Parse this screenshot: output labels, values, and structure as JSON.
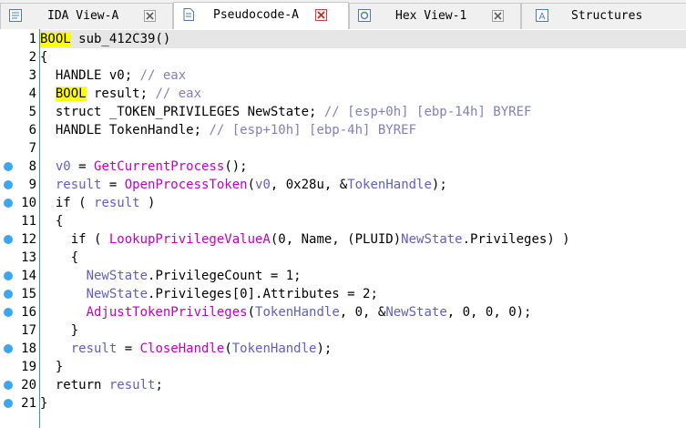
{
  "tabs": [
    {
      "label": "IDA View-A",
      "icon": "ida-view-icon",
      "active": false
    },
    {
      "label": "Pseudocode-A",
      "icon": "pseudocode-icon",
      "active": true
    },
    {
      "label": "Hex View-1",
      "icon": "hex-view-icon",
      "active": false
    },
    {
      "label": "Structures",
      "icon": "structures-icon",
      "active": false
    }
  ],
  "colors": {
    "function": "#c000c0",
    "comment": "#7f7fbf",
    "variable": "#5f5fbf",
    "highlight": "#ffff00",
    "breakpoint": "#3da6f0"
  },
  "code": {
    "lines": [
      {
        "n": "1",
        "bp": false,
        "segments": [
          [
            "kw",
            "BOOL"
          ],
          [
            "t",
            " sub_412C39()"
          ]
        ]
      },
      {
        "n": "2",
        "bp": false,
        "segments": [
          [
            "t",
            "{"
          ]
        ]
      },
      {
        "n": "3",
        "bp": false,
        "segments": [
          [
            "t",
            "  HANDLE v0; "
          ],
          [
            "cm",
            "// eax"
          ]
        ]
      },
      {
        "n": "4",
        "bp": false,
        "segments": [
          [
            "t",
            "  "
          ],
          [
            "kw",
            "BOOL"
          ],
          [
            "t",
            " result; "
          ],
          [
            "cm",
            "// eax"
          ]
        ]
      },
      {
        "n": "5",
        "bp": false,
        "segments": [
          [
            "t",
            "  struct _TOKEN_PRIVILEGES NewState; "
          ],
          [
            "cm",
            "// [esp+0h] [ebp-14h] BYREF"
          ]
        ]
      },
      {
        "n": "6",
        "bp": false,
        "segments": [
          [
            "t",
            "  HANDLE TokenHandle; "
          ],
          [
            "cm",
            "// [esp+10h] [ebp-4h] BYREF"
          ]
        ]
      },
      {
        "n": "7",
        "bp": false,
        "segments": [
          [
            "t",
            ""
          ]
        ]
      },
      {
        "n": "8",
        "bp": true,
        "segments": [
          [
            "t",
            "  "
          ],
          [
            "var",
            "v0"
          ],
          [
            "t",
            " = "
          ],
          [
            "fn",
            "GetCurrentProcess"
          ],
          [
            "t",
            "();"
          ]
        ]
      },
      {
        "n": "9",
        "bp": true,
        "segments": [
          [
            "t",
            "  "
          ],
          [
            "var",
            "result"
          ],
          [
            "t",
            " = "
          ],
          [
            "fn",
            "OpenProcessToken"
          ],
          [
            "t",
            "("
          ],
          [
            "var",
            "v0"
          ],
          [
            "t",
            ", 0x28u, &"
          ],
          [
            "var",
            "TokenHandle"
          ],
          [
            "t",
            ");"
          ]
        ]
      },
      {
        "n": "10",
        "bp": true,
        "segments": [
          [
            "t",
            "  if ( "
          ],
          [
            "var",
            "result"
          ],
          [
            "t",
            " )"
          ]
        ]
      },
      {
        "n": "11",
        "bp": false,
        "segments": [
          [
            "t",
            "  {"
          ]
        ]
      },
      {
        "n": "12",
        "bp": true,
        "segments": [
          [
            "t",
            "    if ( "
          ],
          [
            "fn",
            "LookupPrivilegeValueA"
          ],
          [
            "t",
            "(0, Name, (PLUID)"
          ],
          [
            "var",
            "NewState"
          ],
          [
            "t",
            ".Privileges) )"
          ]
        ]
      },
      {
        "n": "13",
        "bp": false,
        "segments": [
          [
            "t",
            "    {"
          ]
        ]
      },
      {
        "n": "14",
        "bp": true,
        "segments": [
          [
            "t",
            "      "
          ],
          [
            "var",
            "NewState"
          ],
          [
            "t",
            ".PrivilegeCount = 1;"
          ]
        ]
      },
      {
        "n": "15",
        "bp": true,
        "segments": [
          [
            "t",
            "      "
          ],
          [
            "var",
            "NewState"
          ],
          [
            "t",
            ".Privileges[0].Attributes = 2;"
          ]
        ]
      },
      {
        "n": "16",
        "bp": true,
        "segments": [
          [
            "t",
            "      "
          ],
          [
            "fn",
            "AdjustTokenPrivileges"
          ],
          [
            "t",
            "("
          ],
          [
            "var",
            "TokenHandle"
          ],
          [
            "t",
            ", 0, &"
          ],
          [
            "var",
            "NewState"
          ],
          [
            "t",
            ", 0, 0, 0);"
          ]
        ]
      },
      {
        "n": "17",
        "bp": false,
        "segments": [
          [
            "t",
            "    }"
          ]
        ]
      },
      {
        "n": "18",
        "bp": true,
        "segments": [
          [
            "t",
            "    "
          ],
          [
            "var",
            "result"
          ],
          [
            "t",
            " = "
          ],
          [
            "fn",
            "CloseHandle"
          ],
          [
            "t",
            "("
          ],
          [
            "var",
            "TokenHandle"
          ],
          [
            "t",
            ");"
          ]
        ]
      },
      {
        "n": "19",
        "bp": false,
        "segments": [
          [
            "t",
            "  }"
          ]
        ]
      },
      {
        "n": "20",
        "bp": true,
        "segments": [
          [
            "t",
            "  return "
          ],
          [
            "var",
            "result"
          ],
          [
            "t",
            ";"
          ]
        ]
      },
      {
        "n": "21",
        "bp": true,
        "segments": [
          [
            "t",
            "}"
          ]
        ]
      }
    ]
  }
}
